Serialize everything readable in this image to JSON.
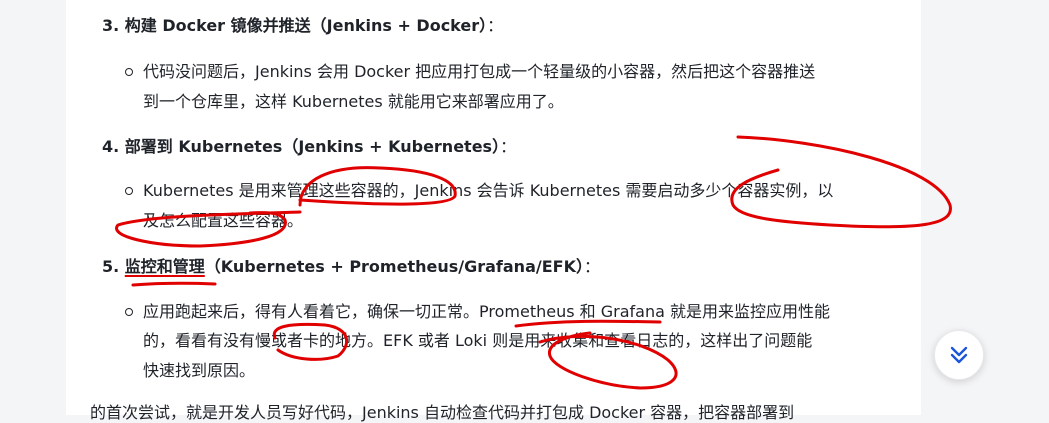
{
  "sections": [
    {
      "heading": "3. 构建 Docker 镜像并推送（Jenkins + Docker）",
      "colon": "：",
      "lines": [
        "代码没问题后，Jenkins 会用 Docker 把应用打包成一个轻量级的小容器，然后把这个容器推送",
        "到一个仓库里，这样 Kubernetes 就能用它来部署应用了。"
      ]
    },
    {
      "heading": "4. 部署到 Kubernetes（Jenkins + Kubernetes）",
      "colon": "：",
      "lines": [
        "Kubernetes 是用来管理这些容器的，Jenkins 会告诉 Kubernetes 需要启动多少个容器实例，以",
        "及怎么配置这些容器。"
      ]
    },
    {
      "heading_num": "5. ",
      "heading_marked": "监控和管理",
      "heading_rest": "（Kubernetes + Prometheus/Grafana/EFK）",
      "colon": "：",
      "lines": [
        "应用跑起来后，得有人看着它，确保一切正常。Prometheus 和 Grafana 就是用来监控应用性能",
        "的，看看有没有慢或者卡的地方。EFK 或者 Loki 则是用来收集和查看日志的，这样出了问题能",
        "快速找到原因。"
      ]
    }
  ],
  "cut_off_line": "的首次尝试，就是开发人员写好代码，Jenkins 自动检查代码并打包成 Docker 容器，把容器部署到",
  "scroll_button": {
    "icon": "chevrons-down-icon"
  },
  "colors": {
    "annotation": "#e10000",
    "accent": "#1a56db"
  }
}
